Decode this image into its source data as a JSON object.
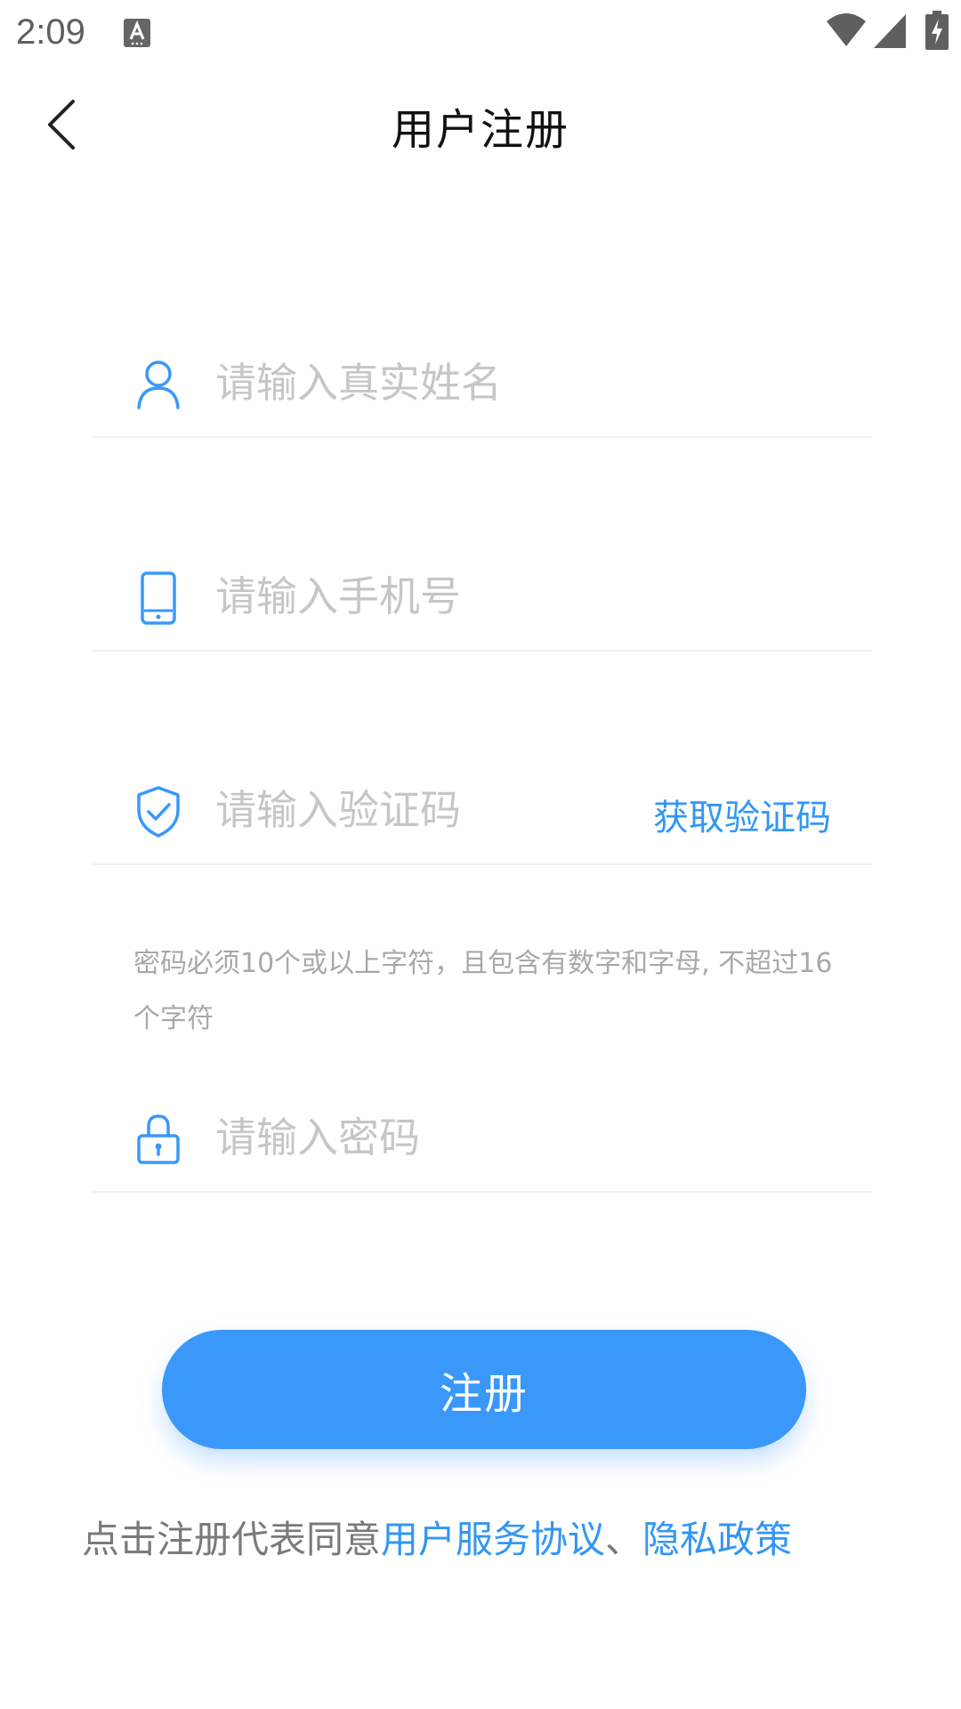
{
  "status_bar": {
    "time": "2:09",
    "icons": [
      "ime-a-icon",
      "wifi-icon",
      "cell-signal-icon",
      "battery-charging-icon"
    ]
  },
  "header": {
    "title": "用户注册",
    "back_icon": "chevron-left-icon"
  },
  "form": {
    "name": {
      "placeholder": "请输入真实姓名",
      "value": "",
      "icon": "user-icon"
    },
    "phone": {
      "placeholder": "请输入手机号",
      "value": "",
      "icon": "phone-icon"
    },
    "code": {
      "placeholder": "请输入验证码",
      "value": "",
      "icon": "shield-check-icon",
      "action_label": "获取验证码"
    },
    "password_hint": "密码必须10个或以上字符，且包含有数字和字母, 不超过16个字符",
    "password": {
      "placeholder": "请输入密码",
      "value": "",
      "icon": "lock-icon"
    }
  },
  "submit": {
    "label": "注册"
  },
  "agreement": {
    "prefix": "点击注册代表同意",
    "terms_link": "用户服务协议",
    "separator": "、",
    "privacy_link": "隐私政策"
  },
  "colors": {
    "accent": "#3a98fa",
    "link": "#3396f5",
    "placeholder": "#c6c6c6",
    "hint": "#a8a8a8"
  }
}
